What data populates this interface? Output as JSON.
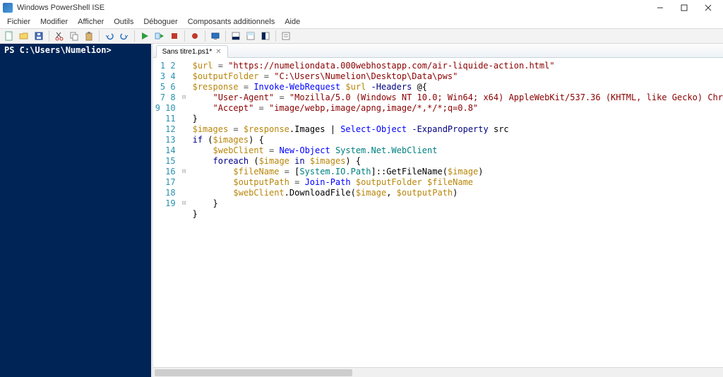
{
  "titlebar": {
    "title": "Windows PowerShell ISE"
  },
  "menubar": {
    "items": [
      "Fichier",
      "Modifier",
      "Afficher",
      "Outils",
      "Déboguer",
      "Composants additionnels",
      "Aide"
    ]
  },
  "toolbar_icons": [
    "new-icon",
    "open-icon",
    "save-icon",
    "sep",
    "cut-icon",
    "copy-icon",
    "paste-icon",
    "sep",
    "undo-icon",
    "redo-icon",
    "sep",
    "run-icon",
    "run-selection-icon",
    "stop-icon",
    "sep",
    "breakpoint-icon",
    "sep",
    "remote-icon",
    "sep",
    "show-console-icon",
    "show-script-icon",
    "show-both-icon",
    "sep",
    "command-addon-icon"
  ],
  "console": {
    "prompt": "PS C:\\Users\\Numelion>"
  },
  "tab": {
    "label": "Sans titre1.ps1*"
  },
  "line_count": 19,
  "fold_markers": {
    "4": "⊟",
    "11": "⊟",
    "14": "⊟"
  },
  "code": {
    "1": [
      [
        "s-var",
        "$url"
      ],
      [
        "s-op",
        " = "
      ],
      [
        "s-str",
        "\"https://numeliondata.000webhostapp.com/air-liquide-action.html\""
      ]
    ],
    "2": [
      [
        "s-var",
        "$outputFolder"
      ],
      [
        "s-op",
        " = "
      ],
      [
        "s-str",
        "\"C:\\Users\\Numelion\\Desktop\\Data\\pws\""
      ]
    ],
    "3": [
      [
        "",
        ""
      ]
    ],
    "4": [
      [
        "s-var",
        "$response"
      ],
      [
        "s-op",
        " = "
      ],
      [
        "s-cmd",
        "Invoke-WebRequest"
      ],
      [
        "",
        " "
      ],
      [
        "s-var",
        "$url"
      ],
      [
        "",
        " "
      ],
      [
        "s-param",
        "-Headers"
      ],
      [
        "",
        " "
      ],
      [
        "s-punc",
        "@{"
      ]
    ],
    "5": [
      [
        "",
        "    "
      ],
      [
        "s-str",
        "\"User-Agent\""
      ],
      [
        "s-op",
        " = "
      ],
      [
        "s-str",
        "\"Mozilla/5.0 (Windows NT 10.0; Win64; x64) AppleWebKit/537.36 (KHTML, like Gecko) Chr"
      ]
    ],
    "6": [
      [
        "",
        "    "
      ],
      [
        "s-str",
        "\"Accept\""
      ],
      [
        "s-op",
        " = "
      ],
      [
        "s-str",
        "\"image/webp,image/apng,image/*,*/*;q=0.8\""
      ]
    ],
    "7": [
      [
        "s-punc",
        "}"
      ]
    ],
    "8": [
      [
        "",
        ""
      ]
    ],
    "9": [
      [
        "s-var",
        "$images"
      ],
      [
        "s-op",
        " = "
      ],
      [
        "s-var",
        "$response"
      ],
      [
        "s-punc",
        "."
      ],
      [
        "s-prop",
        "Images"
      ],
      [
        "",
        " "
      ],
      [
        "s-punc",
        "|"
      ],
      [
        "",
        " "
      ],
      [
        "s-cmd",
        "Select-Object"
      ],
      [
        "",
        " "
      ],
      [
        "s-param",
        "-ExpandProperty"
      ],
      [
        "",
        " "
      ],
      [
        "s-prop",
        "src"
      ]
    ],
    "10": [
      [
        "",
        ""
      ]
    ],
    "11": [
      [
        "s-kw",
        "if"
      ],
      [
        "",
        " "
      ],
      [
        "s-punc",
        "("
      ],
      [
        "s-var",
        "$images"
      ],
      [
        "s-punc",
        ")"
      ],
      [
        "",
        " "
      ],
      [
        "s-punc",
        "{"
      ]
    ],
    "12": [
      [
        "",
        "    "
      ],
      [
        "s-var",
        "$webClient"
      ],
      [
        "s-op",
        " = "
      ],
      [
        "s-cmd",
        "New-Object"
      ],
      [
        "",
        " "
      ],
      [
        "s-type",
        "System.Net.WebClient"
      ]
    ],
    "13": [
      [
        "",
        ""
      ]
    ],
    "14": [
      [
        "",
        "    "
      ],
      [
        "s-kw",
        "foreach"
      ],
      [
        "",
        " "
      ],
      [
        "s-punc",
        "("
      ],
      [
        "s-var",
        "$image"
      ],
      [
        "",
        " "
      ],
      [
        "s-kw",
        "in"
      ],
      [
        "",
        " "
      ],
      [
        "s-var",
        "$images"
      ],
      [
        "s-punc",
        ")"
      ],
      [
        "",
        " "
      ],
      [
        "s-punc",
        "{"
      ]
    ],
    "15": [
      [
        "",
        "        "
      ],
      [
        "s-var",
        "$fileName"
      ],
      [
        "s-op",
        " = "
      ],
      [
        "s-punc",
        "["
      ],
      [
        "s-type",
        "System.IO.Path"
      ],
      [
        "s-punc",
        "]::"
      ],
      [
        "s-prop",
        "GetFileName"
      ],
      [
        "s-punc",
        "("
      ],
      [
        "s-var",
        "$image"
      ],
      [
        "s-punc",
        ")"
      ]
    ],
    "16": [
      [
        "",
        "        "
      ],
      [
        "s-var",
        "$outputPath"
      ],
      [
        "s-op",
        " = "
      ],
      [
        "s-cmd",
        "Join-Path"
      ],
      [
        "",
        " "
      ],
      [
        "s-var",
        "$outputFolder"
      ],
      [
        "",
        " "
      ],
      [
        "s-var",
        "$fileName"
      ]
    ],
    "17": [
      [
        "",
        "        "
      ],
      [
        "s-var",
        "$webClient"
      ],
      [
        "s-punc",
        "."
      ],
      [
        "s-prop",
        "DownloadFile"
      ],
      [
        "s-punc",
        "("
      ],
      [
        "s-var",
        "$image"
      ],
      [
        "s-punc",
        ", "
      ],
      [
        "s-var",
        "$outputPath"
      ],
      [
        "s-punc",
        ")"
      ]
    ],
    "18": [
      [
        "",
        "    "
      ],
      [
        "s-punc",
        "}"
      ]
    ],
    "19": [
      [
        "s-punc",
        "}"
      ]
    ]
  }
}
